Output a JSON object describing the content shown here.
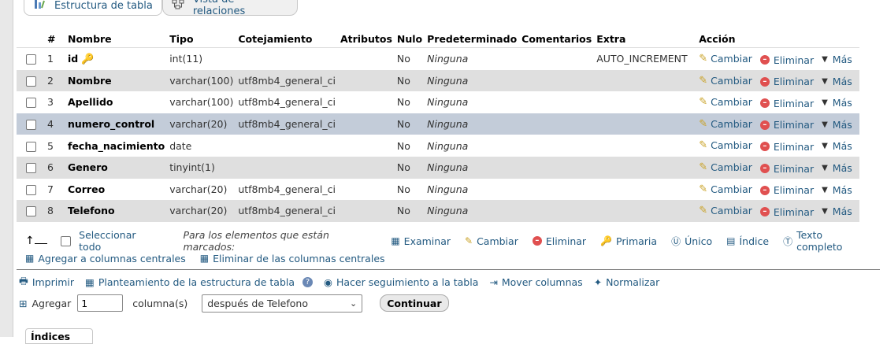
{
  "tabs": [
    {
      "label": "Estructura de tabla",
      "icon": "structure-icon"
    },
    {
      "label": "Vista de relaciones",
      "icon": "relations-icon"
    }
  ],
  "columns": [
    "#",
    "Nombre",
    "Tipo",
    "Cotejamiento",
    "Atributos",
    "Nulo",
    "Predeterminado",
    "Comentarios",
    "Extra",
    "Acción"
  ],
  "rows": [
    {
      "num": "1",
      "name": "id",
      "type": "int(11)",
      "collation": "",
      "attributes": "",
      "null": "No",
      "default": "Ninguna",
      "comments": "",
      "extra": "AUTO_INCREMENT",
      "primary_key": true
    },
    {
      "num": "2",
      "name": "Nombre",
      "type": "varchar(100)",
      "collation": "utf8mb4_general_ci",
      "attributes": "",
      "null": "No",
      "default": "Ninguna",
      "comments": "",
      "extra": ""
    },
    {
      "num": "3",
      "name": "Apellido",
      "type": "varchar(100)",
      "collation": "utf8mb4_general_ci",
      "attributes": "",
      "null": "No",
      "default": "Ninguna",
      "comments": "",
      "extra": ""
    },
    {
      "num": "4",
      "name": "numero_control",
      "type": "varchar(20)",
      "collation": "utf8mb4_general_ci",
      "attributes": "",
      "null": "No",
      "default": "Ninguna",
      "comments": "",
      "extra": ""
    },
    {
      "num": "5",
      "name": "fecha_nacimiento",
      "type": "date",
      "collation": "",
      "attributes": "",
      "null": "No",
      "default": "Ninguna",
      "comments": "",
      "extra": ""
    },
    {
      "num": "6",
      "name": "Genero",
      "type": "tinyint(1)",
      "collation": "",
      "attributes": "",
      "null": "No",
      "default": "Ninguna",
      "comments": "",
      "extra": ""
    },
    {
      "num": "7",
      "name": "Correo",
      "type": "varchar(20)",
      "collation": "utf8mb4_general_ci",
      "attributes": "",
      "null": "No",
      "default": "Ninguna",
      "comments": "",
      "extra": ""
    },
    {
      "num": "8",
      "name": "Telefono",
      "type": "varchar(20)",
      "collation": "utf8mb4_general_ci",
      "attributes": "",
      "null": "No",
      "default": "Ninguna",
      "comments": "",
      "extra": ""
    }
  ],
  "row_actions": {
    "change": "Cambiar",
    "drop": "Eliminar",
    "more": "Más"
  },
  "bulk": {
    "select_all": "Seleccionar todo",
    "with_selected": "Para los elementos que están marcados:",
    "browse": "Examinar",
    "change": "Cambiar",
    "drop": "Eliminar",
    "primary": "Primaria",
    "unique": "Único",
    "index": "Índice",
    "fulltext": "Texto completo",
    "add_central": "Agregar a columnas centrales",
    "remove_central": "Eliminar de las columnas centrales"
  },
  "tools": {
    "print": "Imprimir",
    "propose": "Planteamiento de la estructura de tabla",
    "track": "Hacer seguimiento a la tabla",
    "move": "Mover columnas",
    "normalize": "Normalizar"
  },
  "add": {
    "label": "Agregar",
    "count": "1",
    "unit": "columna(s)",
    "position": "después de Telefono",
    "submit": "Continuar"
  },
  "indexes_tab": "Índices"
}
